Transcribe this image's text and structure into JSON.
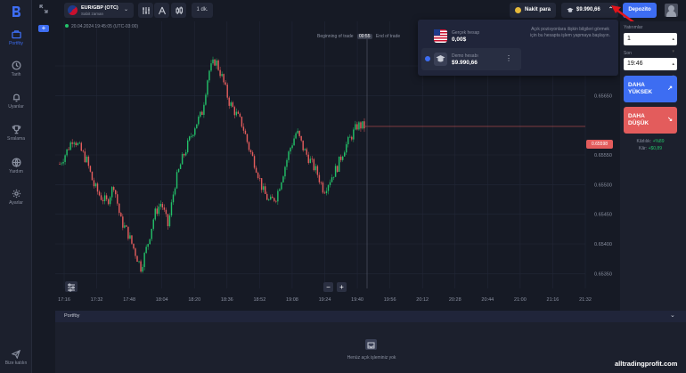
{
  "colors": {
    "accent": "#3d6df2",
    "up": "#23c169",
    "down": "#e35c5c",
    "bg": "#161a25"
  },
  "sidebar": {
    "items": [
      {
        "label": "Portföy",
        "icon": "briefcase-icon"
      },
      {
        "label": "Tarih",
        "icon": "clock-icon"
      },
      {
        "label": "Uyarılar",
        "icon": "bell-icon"
      },
      {
        "label": "Sıralama",
        "icon": "trophy-icon"
      },
      {
        "label": "Yardım",
        "icon": "globe-icon"
      },
      {
        "label": "Ayarlar",
        "icon": "gear-icon"
      }
    ],
    "chat_label": "Bize katılın"
  },
  "topbar": {
    "asset_name": "EUR/GBP (OTC)",
    "asset_type": "Sabit zaman",
    "timeframe": "1 dk.",
    "cash_label": "Nakit para",
    "balance": "$9.990,66",
    "deposit_label": "Depozito"
  },
  "chart": {
    "timestamp": "20.04.2024 19:45:05 (UTC-03:00)",
    "begin_label": "Beginning of trade",
    "timer": "00:55",
    "end_label": "End of trade",
    "current_price": "0.65598",
    "zoom_minus": "−",
    "zoom_plus": "+"
  },
  "chart_data": {
    "type": "candlestick",
    "x_ticks": [
      "17:16",
      "17:32",
      "17:48",
      "18:04",
      "18:20",
      "18:36",
      "18:52",
      "19:08",
      "19:24",
      "19:40",
      "19:56",
      "20:12",
      "20:28",
      "20:44",
      "21:00",
      "21:16",
      "21:32"
    ],
    "y_ticks": [
      "0.65700",
      "0.65650",
      "0.65550",
      "0.65500",
      "0.65450",
      "0.65400",
      "0.65350"
    ],
    "ylim": [
      0.65325,
      0.65775
    ],
    "close_series": [
      0.65535,
      0.65555,
      0.6558,
      0.6556,
      0.6554,
      0.655,
      0.6548,
      0.6547,
      0.655,
      0.6544,
      0.6542,
      0.6539,
      0.6536,
      0.654,
      0.6545,
      0.6547,
      0.6543,
      0.655,
      0.6554,
      0.6557,
      0.656,
      0.6562,
      0.6569,
      0.6571,
      0.6568,
      0.6564,
      0.6562,
      0.656,
      0.6556,
      0.6553,
      0.6549,
      0.6547,
      0.6548,
      0.6552,
      0.6556,
      0.6559,
      0.6556,
      0.6554,
      0.6552,
      0.6549,
      0.6551,
      0.6553,
      0.6556,
      0.6558,
      0.656,
      0.65598
    ]
  },
  "accounts": {
    "real": {
      "name": "Gerçek hesap",
      "balance": "0,00$"
    },
    "demo": {
      "name": "Demo hesabı",
      "balance": "$9.990,66"
    },
    "message": "Açık pozisyonlara ilişkin bilgileri görmek için bu hesapta işlem yapmaya başlayın."
  },
  "trade_panel": {
    "investment_label": "Yatırımlar",
    "investment_value": "1",
    "end_label": "Son",
    "end_value": "19:46",
    "up_label": "DAHA YÜKSEK",
    "down_label": "DAHA DÜŞÜK",
    "profit_label": "Kârlılık:",
    "profit_value": "+%89",
    "gain_label": "Kâr:",
    "gain_value": "+$0,89"
  },
  "portfolio": {
    "title": "Portföy",
    "empty_text": "Henüz açık işleminiz yok"
  },
  "watermark": "alltradingprofit.com"
}
